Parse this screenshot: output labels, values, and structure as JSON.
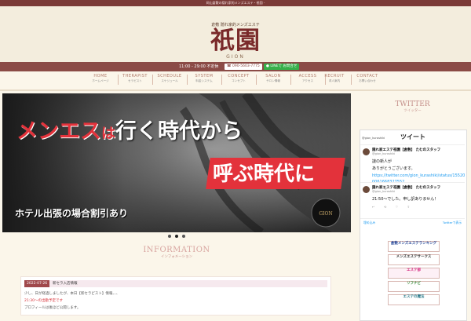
{
  "topbar": {
    "text": "岡山倉敷の隠れ家的メンズエステ・祇園 -"
  },
  "header": {
    "tagline": "倉敷 隠れ家的メンズエステ",
    "logo_text": "祇園",
    "logo_sub": "GION",
    "hours": "11:00 - 29:00 不定休",
    "tel": "090-5603-7775",
    "line_label": "LINEで お問合せ"
  },
  "nav": [
    {
      "en": "HOME",
      "jp": "ホームページ"
    },
    {
      "en": "THERAPIST",
      "jp": "セラピスト"
    },
    {
      "en": "SCHEDULE",
      "jp": "スケジュール"
    },
    {
      "en": "SYSTEM",
      "jp": "料金システム"
    },
    {
      "en": "CONCEPT",
      "jp": "コンセプト"
    },
    {
      "en": "SALON",
      "jp": "サロン情報"
    },
    {
      "en": "ACCESS",
      "jp": "アクセス"
    },
    {
      "en": "RECRUIT",
      "jp": "求人案内"
    },
    {
      "en": "CONTACT",
      "jp": "お問い合わせ"
    }
  ],
  "slider": {
    "line1_red": "メンエス",
    "line1_small": "は",
    "line1_rest": "行く時代から",
    "line2": "呼ぶ時代に",
    "caption": "ホテル出張の場合割引あり",
    "active_dot": 1
  },
  "information": {
    "title_en": "INFORMATION",
    "title_jp": "インフォメーション",
    "news": {
      "date": "2022-07-26",
      "title": "新セラ入店情報",
      "line1": "少し、日が経過しましたが、本日【新セラピスト】情報、、、",
      "line2": "21:30〜の出勤予定です",
      "line3": "プロフィールは後ほど公開します。"
    }
  },
  "twitter": {
    "title_en": "TWITTER",
    "title_jp": "ツイッター",
    "header_sub": "@gion_kurashiki",
    "header_main": "ツイート",
    "tweets": [
      {
        "name": "隠れ家エステ祇園【倉敷】 たむのスタッフ",
        "handle": "@gion_kurashiki",
        "lines": [
          "謎の新人が",
          "ありがとうございます。"
        ],
        "link": "https://twitter.com/gion_kurashiki/status/15520",
        "link2": "0061668327552",
        "actions": [
          "↩",
          "⟲",
          "♡",
          "⇪"
        ]
      },
      {
        "name": "隠れ家エステ祇園【倉敷】 たむのスタッフ",
        "handle": "@gion_kurashiki",
        "lines": [
          "21:50〜でした。申し訳ありません！"
        ],
        "link": "",
        "link2": "",
        "actions": [
          "↩",
          "⟲",
          "♡",
          "⇪"
        ]
      }
    ],
    "footer_left": "埋め込み",
    "footer_right": "Twitterで表示"
  },
  "banners": [
    {
      "title": "倉敷メンズエステランキング",
      "sub": ""
    },
    {
      "title": "メンズエステサークス",
      "sub": ""
    },
    {
      "title": "エステ部",
      "sub": ""
    },
    {
      "title": "リフナビ",
      "sub": ""
    },
    {
      "title": "エステの魔法",
      "sub": ""
    }
  ],
  "colors": {
    "brand": "#7a2a2a",
    "accent_red": "#e3323b",
    "bar": "#8b4b46"
  }
}
